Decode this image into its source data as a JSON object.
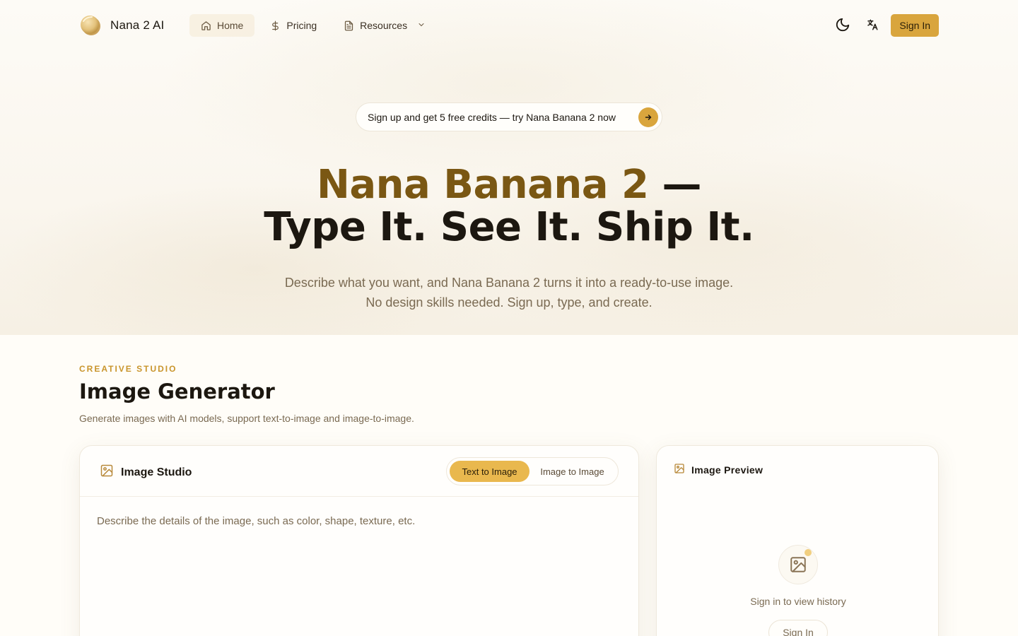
{
  "brand": {
    "name": "Nana 2 AI",
    "logo_icon": "banana-coin-logo-icon"
  },
  "nav": {
    "items": [
      {
        "label": "Home",
        "icon": "home-icon",
        "active": true
      },
      {
        "label": "Pricing",
        "icon": "dollar-icon",
        "active": false
      },
      {
        "label": "Resources",
        "icon": "document-icon",
        "active": false,
        "has_dropdown": true
      }
    ],
    "theme_icon": "moon-icon",
    "language_icon": "translate-icon",
    "signin_label": "Sign In"
  },
  "hero": {
    "promo_text": "Sign up and get 5 free credits — try Nana Banana 2 now",
    "title_accent": "Nana Banana 2",
    "title_dash": " —",
    "title_line2": "Type It. See It. Ship It.",
    "subtitle_line1": "Describe what you want, and Nana Banana 2 turns it into a ready-to-use image.",
    "subtitle_line2": "No design skills needed. Sign up, type, and create."
  },
  "section": {
    "eyebrow": "CREATIVE STUDIO",
    "title": "Image Generator",
    "description": "Generate images with AI models, support text-to-image and image-to-image."
  },
  "studio": {
    "title": "Image Studio",
    "modes": [
      {
        "label": "Text to Image",
        "selected": true
      },
      {
        "label": "Image to Image",
        "selected": false
      }
    ],
    "prompt_placeholder": "Describe the details of the image, such as color, shape, texture, etc.",
    "prompt_value": ""
  },
  "preview": {
    "title": "Image Preview",
    "empty_text": "Sign in to view history",
    "signin_label": "Sign In"
  },
  "colors": {
    "accent": "#d9a53d",
    "accent_dark": "#7a5713",
    "text": "#1c1710",
    "muted": "#7a6a52",
    "background": "#fffdf8"
  }
}
